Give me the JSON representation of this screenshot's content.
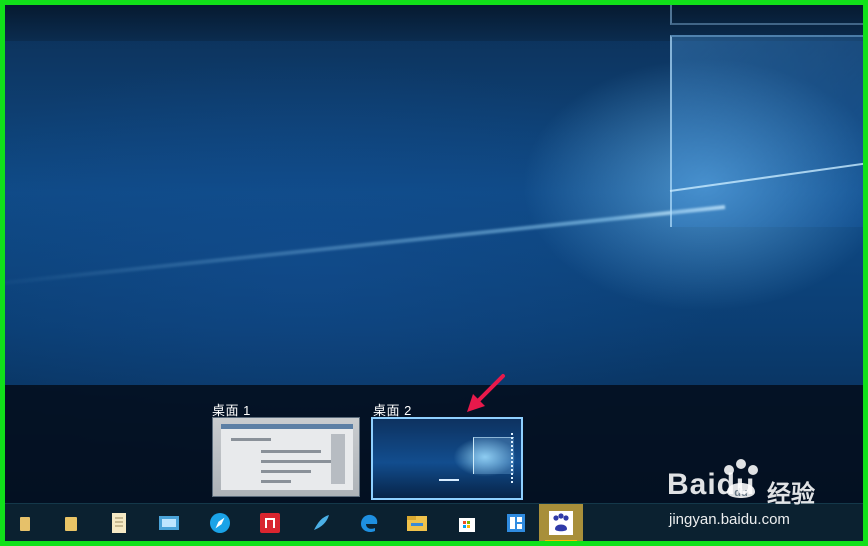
{
  "task_view": {
    "desktops": [
      {
        "label": "桌面 1"
      },
      {
        "label": "桌面 2"
      }
    ]
  },
  "taskbar": {
    "items": [
      {
        "icon": "folder-icon"
      },
      {
        "icon": "folder-icon"
      },
      {
        "icon": "notepad-icon"
      },
      {
        "icon": "screen-app-icon"
      },
      {
        "icon": "browser-compass-icon"
      },
      {
        "icon": "red-app-icon"
      },
      {
        "icon": "feather-icon"
      },
      {
        "icon": "edge-icon"
      },
      {
        "icon": "file-explorer-icon"
      },
      {
        "icon": "store-icon"
      },
      {
        "icon": "blue-app-icon"
      },
      {
        "icon": "baidu-paw-icon"
      }
    ]
  },
  "watermark": {
    "brand": "Baidu",
    "chinese": "经验",
    "url": "jingyan.baidu.com"
  },
  "colors": {
    "frame_border": "#11e01a",
    "arrow": "#e8194b",
    "selected_thumb_border": "#8fd0ff",
    "active_task": "#a88f3a"
  }
}
